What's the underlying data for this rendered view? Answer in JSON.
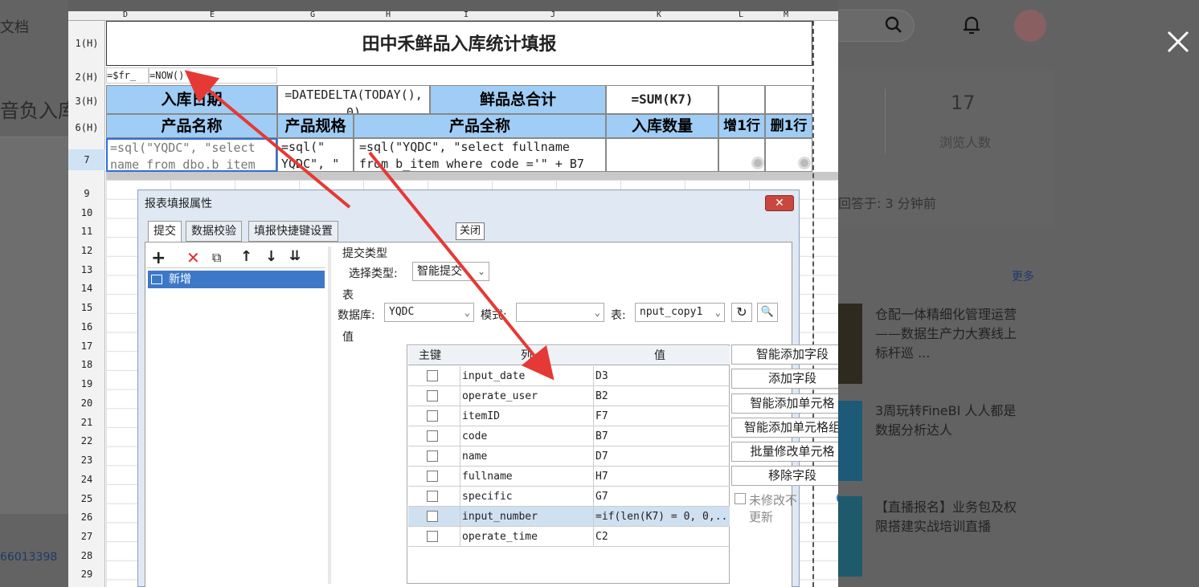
{
  "background": {
    "doc_text": "文档",
    "title_fragment": "音负入库",
    "phone_fragment": "66013398",
    "views_count": "17",
    "views_label": "浏览人数",
    "answered": "回答于: 3 分钟前",
    "more": "更多",
    "news": [
      {
        "title": "仓配一体精细化管理运营——数据生产力大赛线上标杆巡 ..."
      },
      {
        "title": "3周玩转FineBI 人人都是数据分析达人"
      },
      {
        "title": "【直播报名】业务包及权限搭建实战培训直播"
      }
    ]
  },
  "sheet": {
    "col_headers": [
      "D",
      "E",
      "G",
      "H",
      "I",
      "J",
      "K",
      "L",
      "M"
    ],
    "row_labels": [
      "1(H)",
      "2(H)",
      "3(H)",
      "6(H)",
      "7",
      "9",
      "10",
      "11",
      "12",
      "13",
      "14",
      "15",
      "16",
      "17",
      "18",
      "19",
      "20",
      "21",
      "22",
      "23",
      "24",
      "25",
      "26",
      "27",
      "28",
      "29"
    ],
    "title": "田中禾鲜品入库统计填报",
    "row2_cells": [
      "=$fr_",
      "=NOW()"
    ],
    "row3": {
      "label_date": "入库日期",
      "formula_date": "=DATEDELTA(TODAY(),0)",
      "label_total": "鲜品总合计",
      "formula_sum": "=SUM(K7)"
    },
    "headers": [
      "产品名称",
      "产品规格",
      "产品全称",
      "入库数量",
      "增1行",
      "删1行"
    ],
    "row7": {
      "name_formula": "=sql(\"YQDC\", \"select name from dbo.b_item",
      "spec_formula": "=sql(\" YQDC\", \"",
      "fullname_formula": "=sql(\"YQDC\", \"select fullname from b_item where code ='\" + B7"
    }
  },
  "dialog": {
    "title": "报表填报属性",
    "close_tooltip": "关闭",
    "tabs": [
      "提交",
      "数据校验",
      "填报快捷键设置"
    ],
    "tree_item": "新增",
    "submit_type_label": "提交类型",
    "select_type_label": "选择类型:",
    "select_type_value": "智能提交",
    "table_section": "表",
    "db_label": "数据库:",
    "db_value": "YQDC",
    "schema_label": "模式:",
    "schema_value": "",
    "table_label": "表:",
    "table_value": "nput_copy1",
    "value_section": "值",
    "grid_headers": [
      "主键",
      "列",
      "值"
    ],
    "rows": [
      {
        "col": "input_date",
        "val": "D3"
      },
      {
        "col": "operate_user",
        "val": "B2"
      },
      {
        "col": "itemID",
        "val": "F7"
      },
      {
        "col": "code",
        "val": "B7"
      },
      {
        "col": "name",
        "val": "D7"
      },
      {
        "col": "fullname",
        "val": "H7"
      },
      {
        "col": "specific",
        "val": "G7"
      },
      {
        "col": "input_number",
        "val": "=if(len(K7) = 0, 0,..."
      },
      {
        "col": "operate_time",
        "val": "C2"
      }
    ],
    "side_buttons": [
      "智能添加字段",
      "添加字段",
      "智能添加单元格",
      "智能添加单元格组",
      "批量修改单元格",
      "移除字段"
    ],
    "no_update_label": "未修改不更新",
    "colors": {
      "header_fill": "#9fcdf5",
      "selected_row": "#cfe0f0",
      "arrow": "#e53935"
    }
  }
}
